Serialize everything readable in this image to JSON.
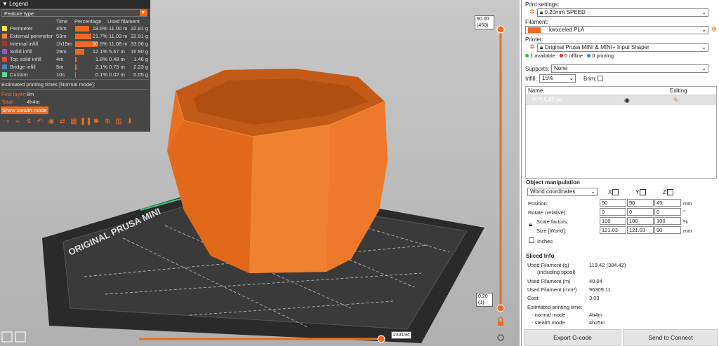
{
  "legend": {
    "title": "Legend",
    "view_type": "Feature type",
    "headers": {
      "time": "Time",
      "percentage": "Percentage",
      "used_filament": "Used filament"
    },
    "rows": [
      {
        "name": "Perimeter",
        "color": "#FFE640",
        "time": "45m",
        "pct": "18.6%",
        "pct_value": 18.6,
        "m": "11.00 m",
        "g": "32.81 g"
      },
      {
        "name": "External perimeter",
        "color": "#FF7D38",
        "time": "53m",
        "pct": "21.7%",
        "pct_value": 21.7,
        "m": "11.03 m",
        "g": "32.91 g"
      },
      {
        "name": "Internal infill",
        "color": "#B03029",
        "time": "1h15m",
        "pct": "30.5%",
        "pct_value": 30.5,
        "m": "11.08 m",
        "g": "33.06 g"
      },
      {
        "name": "Solid infill",
        "color": "#9654CC",
        "time": "29m",
        "pct": "12.1%",
        "pct_value": 12.1,
        "m": "5.67 m",
        "g": "16.90 g"
      },
      {
        "name": "Top solid infill",
        "color": "#F04040",
        "time": "4m",
        "pct": "1.8%",
        "pct_value": 1.8,
        "m": "0.49 m",
        "g": "1.46 g"
      },
      {
        "name": "Bridge infill",
        "color": "#4D80BA",
        "time": "5m",
        "pct": "2.1%",
        "pct_value": 2.1,
        "m": "0.75 m",
        "g": "2.23 g"
      },
      {
        "name": "Custom",
        "color": "#5ED194",
        "time": "10s",
        "pct": "0.1%",
        "pct_value": 0.1,
        "m": "0.02 m",
        "g": "0.05 g"
      }
    ],
    "estimated_label": "Estimated printing times [Normal mode]:",
    "first_layer_label": "First layer:",
    "first_layer_value": "8m",
    "total_label": "Total:",
    "total_value": "4h4m",
    "stealth_button": "Show stealth mode",
    "toolbar_icons": [
      "travel-icon",
      "wipe-icon",
      "retractions-icon",
      "deretractions-icon",
      "seams-icon",
      "tool-changes-icon",
      "color-changes-icon",
      "pause-prints-icon",
      "custom-gcodes-icon",
      "center-of-gravity-icon",
      "shells-icon",
      "tool-marker-icon"
    ]
  },
  "viewport": {
    "bed_label": "ORIGINAL PRUSA MINI",
    "layer_top_value": "90.00",
    "layer_top_index": "(450)",
    "layer_bottom_value": "0.20",
    "layer_bottom_index": "(1)",
    "horizontal_slider_value": "233194",
    "object_color": "#ED6B21"
  },
  "panel": {
    "print_settings_label": "Print settings:",
    "print_settings_value": "0.20mm SPEED",
    "filament_label": "Filament:",
    "filament_value": "kwxceled PLA",
    "filament_color": "#ED6B21",
    "printer_label": "Printer:",
    "printer_value": "Original Prusa MINI & MINI+ Input Shaper",
    "status_available": "1 available",
    "status_offline": "0 offline",
    "status_printing": "0 printing",
    "supports_label": "Supports:",
    "supports_value": "None",
    "infill_label": "Infill:",
    "infill_value": "15%",
    "brim_label": "Brim:",
    "list_name_header": "Name",
    "list_editing_header": "Editing",
    "list_row_name": "ボウル45.stl",
    "object_manipulation_title": "Object manipulation",
    "coordinates_value": "World coordinates",
    "axis_x": "X",
    "axis_y": "Y",
    "axis_z": "Z",
    "position_label": "Position:",
    "position": [
      "90",
      "90",
      "45"
    ],
    "position_unit": "mm",
    "rotate_label": "Rotate (relative):",
    "rotate": [
      "0",
      "0",
      "0"
    ],
    "rotate_unit": "°",
    "scale_label": "Scale factors:",
    "scale": [
      "100",
      "100",
      "100"
    ],
    "scale_unit": "%",
    "size_label": "Size [World]:",
    "size": [
      "121.03",
      "121.03",
      "90"
    ],
    "size_unit": "mm",
    "inches_label": "Inches",
    "sliced_info_title": "Sliced Info",
    "used_filament_g_label": "Used Filament (g)",
    "used_filament_g_value": "119.42 (384.42)",
    "including_spool_label": "(including spool)",
    "used_filament_m_label": "Used Filament (m)",
    "used_filament_m_value": "40.04",
    "used_filament_mm3_label": "Used Filament (mm³)",
    "used_filament_mm3_value": "96309.11",
    "cost_label": "Cost",
    "cost_value": "3.03",
    "estimated_time_label": "Estimated printing time:",
    "normal_mode_label": "- normal mode",
    "normal_mode_value": "4h4m",
    "stealth_mode_label": "- stealth mode",
    "stealth_mode_value": "4h25m",
    "export_button": "Export G-code",
    "send_button": "Send to Connect"
  }
}
